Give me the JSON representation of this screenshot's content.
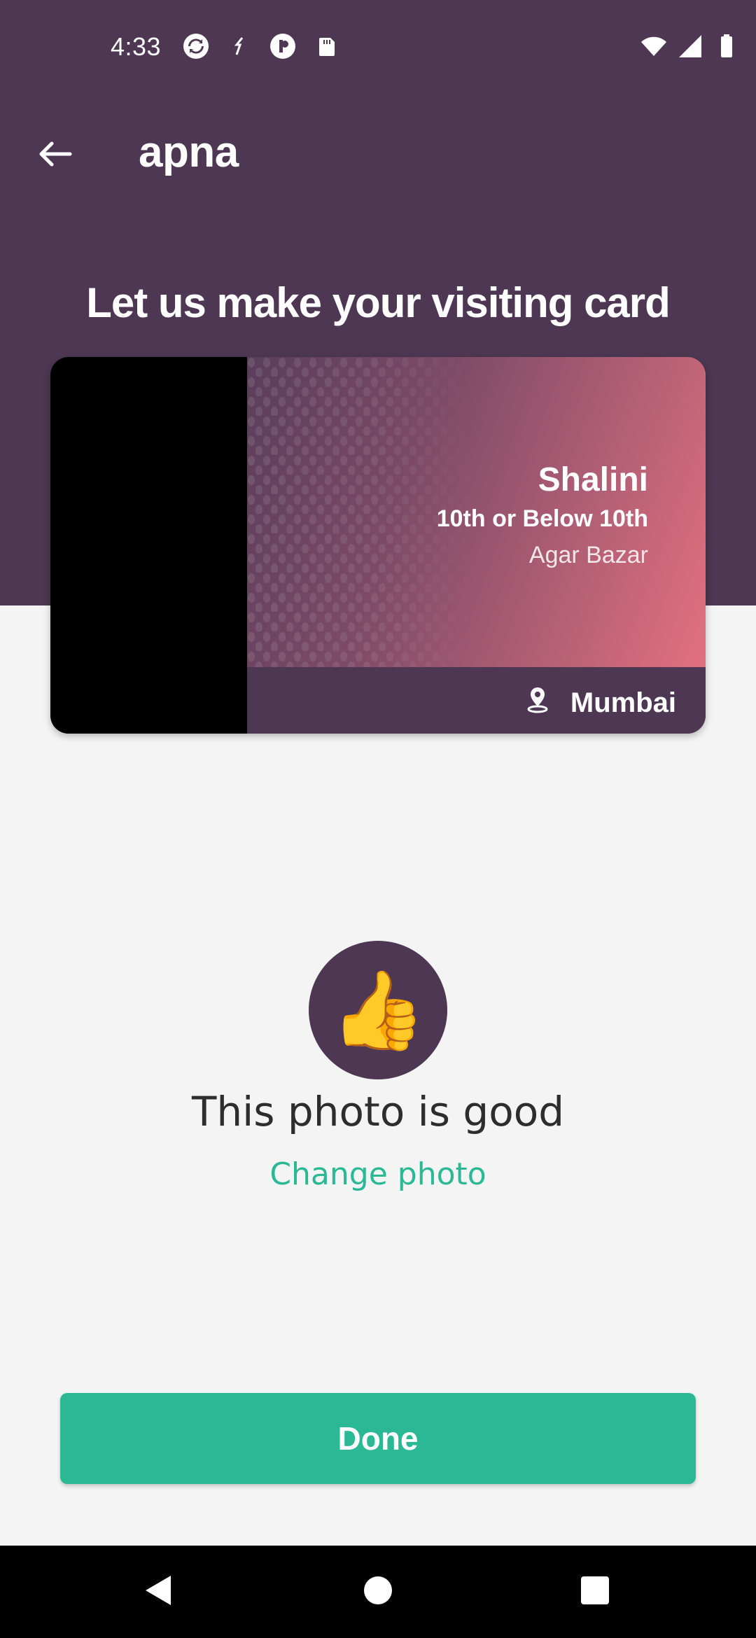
{
  "status_bar": {
    "time": "4:33",
    "left_icons": [
      "sync-icon",
      "data-transfer-icon",
      "app-notification-icon",
      "sd-card-icon"
    ],
    "right_icons": [
      "wifi-icon",
      "cell-signal-icon",
      "battery-icon"
    ]
  },
  "app_bar": {
    "back_icon": "arrow-left-icon",
    "title": "apna"
  },
  "heading": "Let us make your visiting card",
  "card": {
    "name": "Shalini",
    "education": "10th or Below 10th",
    "area": "Agar Bazar",
    "city": "Mumbai",
    "location_icon": "location-pin-icon"
  },
  "photo_status": {
    "emoji": "👍",
    "message": "This photo is good",
    "change_label": "Change photo"
  },
  "done_label": "Done",
  "colors": {
    "primary": "#4d3752",
    "accent": "#2bb894",
    "background": "#f4f4f4"
  },
  "nav_bar": [
    "back-triangle-icon",
    "home-circle-icon",
    "recents-square-icon"
  ]
}
